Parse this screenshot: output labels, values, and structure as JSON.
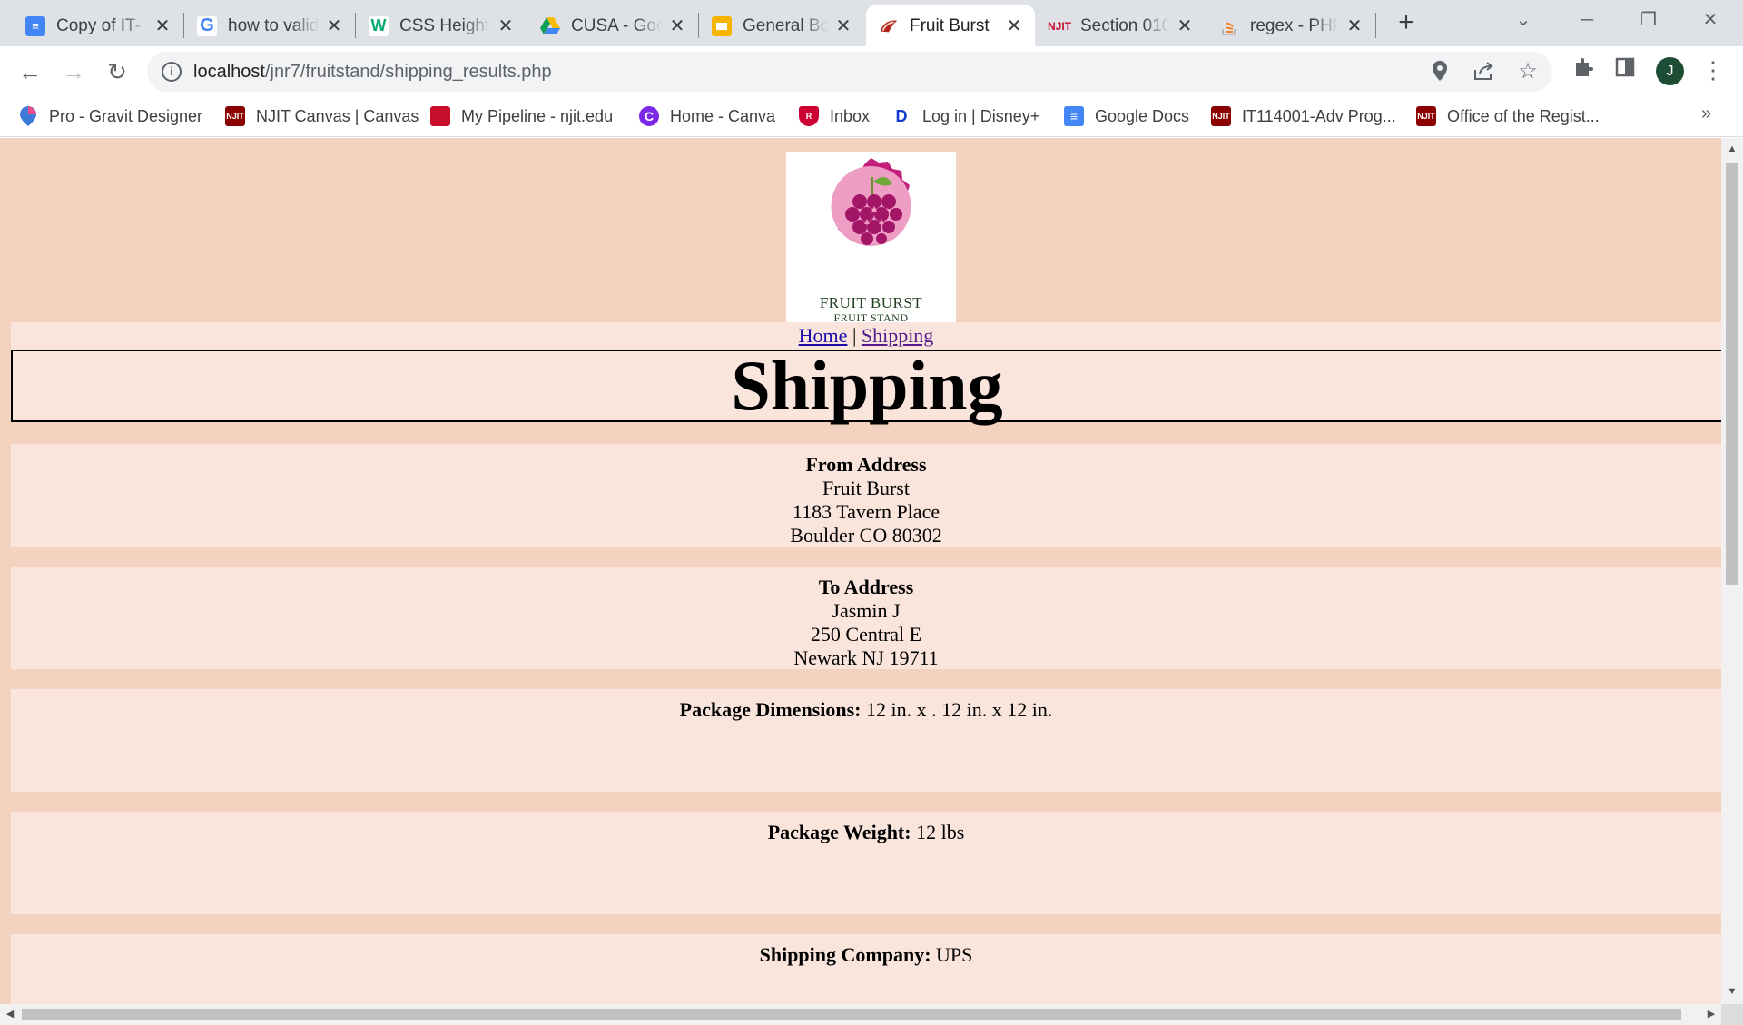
{
  "browser": {
    "tabs": [
      {
        "title": "Copy of IT-",
        "favicon": "google-docs-icon",
        "color": "#4285f4"
      },
      {
        "title": "how to valid",
        "favicon": "google-icon",
        "color": "#ea4335"
      },
      {
        "title": "CSS Height",
        "favicon": "w3schools-icon",
        "color": "#04aa6d"
      },
      {
        "title": "CUSA - Goo",
        "favicon": "google-drive-icon",
        "color": "#fbbc04"
      },
      {
        "title": "General Bo",
        "favicon": "google-slides-icon",
        "color": "#f4b400"
      },
      {
        "title": "Fruit Burst",
        "favicon": "fruit-burst-icon",
        "color": "#b3261e",
        "active": true
      },
      {
        "title": "Section 010",
        "favicon": "njit-icon",
        "color": "#c8102e"
      },
      {
        "title": "regex - PHP",
        "favicon": "stackoverflow-icon",
        "color": "#f48024"
      }
    ],
    "url_host": "localhost",
    "url_path": "/jnr7/fruitstand/shipping_results.php",
    "profile_initial": "J",
    "bookmarks": [
      {
        "label": "Pro - Gravit Designer",
        "icon": "gravit-icon",
        "color": "#3d7bd9"
      },
      {
        "label": "NJIT Canvas | Canvas",
        "icon": "njit-icon",
        "color": "#8b0000"
      },
      {
        "label": "My Pipeline - njit.edu",
        "icon": "pipeline-icon",
        "color": "#c8102e"
      },
      {
        "label": "Home - Canva",
        "icon": "canva-icon",
        "color": "#7d2ae8"
      },
      {
        "label": "Inbox",
        "icon": "rutgers-icon",
        "color": "#cc0033"
      },
      {
        "label": "Log in | Disney+",
        "icon": "disney-icon",
        "color": "#113ccf"
      },
      {
        "label": "Google Docs",
        "icon": "google-docs-icon",
        "color": "#4285f4"
      },
      {
        "label": "IT114001-Adv Prog...",
        "icon": "njit-icon",
        "color": "#8b0000"
      },
      {
        "label": "Office of the Regist...",
        "icon": "njit-icon",
        "color": "#8b0000"
      }
    ]
  },
  "page": {
    "logo": {
      "line1": "FRUIT BURST",
      "line2": "FRUIT STAND"
    },
    "nav": {
      "home": "Home",
      "separator": "|",
      "shipping": "Shipping"
    },
    "title": "Shipping",
    "from": {
      "heading": "From Address",
      "name": "Fruit Burst",
      "street": "1183 Tavern Place",
      "city": "Boulder CO 80302"
    },
    "to": {
      "heading": "To Address",
      "name": "Jasmin J",
      "street": "250 Central E",
      "city": "Newark NJ 19711"
    },
    "dimensions": {
      "label": "Package Dimensions:",
      "value": "12 in. x . 12 in. x 12 in."
    },
    "weight": {
      "label": "Package Weight:",
      "value": "12 lbs"
    },
    "company": {
      "label": "Shipping Company:",
      "value": "UPS"
    }
  }
}
